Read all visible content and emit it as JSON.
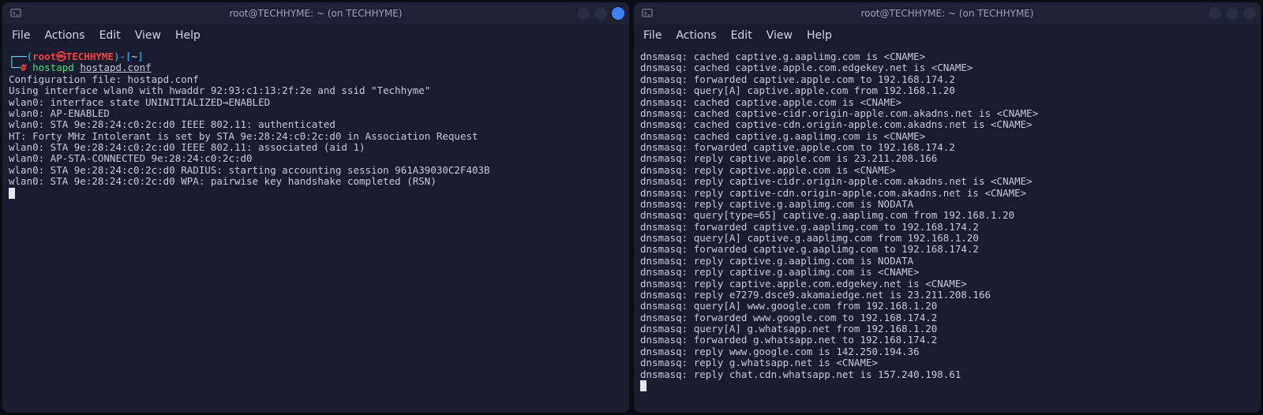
{
  "menus": [
    "File",
    "Actions",
    "Edit",
    "View",
    "Help"
  ],
  "left": {
    "title": "root@TECHHYME: ~ (on TECHHYME)",
    "prompt": {
      "user": "root",
      "symbol": "㉿",
      "host": "TECHHYME",
      "cwd": "~",
      "marker": "#",
      "command": "hostapd",
      "arg": "hostapd.conf"
    },
    "output": [
      "Configuration file: hostapd.conf",
      "Using interface wlan0 with hwaddr 92:93:c1:13:2f:2e and ssid \"Techhyme\"",
      "wlan0: interface state UNINITIALIZED→ENABLED",
      "wlan0: AP-ENABLED",
      "wlan0: STA 9e:28:24:c0:2c:d0 IEEE 802.11: authenticated",
      "HT: Forty MHz Intolerant is set by STA 9e:28:24:c0:2c:d0 in Association Request",
      "wlan0: STA 9e:28:24:c0:2c:d0 IEEE 802.11: associated (aid 1)",
      "wlan0: AP-STA-CONNECTED 9e:28:24:c0:2c:d0",
      "wlan0: STA 9e:28:24:c0:2c:d0 RADIUS: starting accounting session 961A39030C2F403B",
      "wlan0: STA 9e:28:24:c0:2c:d0 WPA: pairwise key handshake completed (RSN)"
    ]
  },
  "right": {
    "title": "root@TECHHYME: ~ (on TECHHYME)",
    "output": [
      "dnsmasq: cached captive.g.aaplimg.com is <CNAME>",
      "dnsmasq: cached captive.apple.com.edgekey.net is <CNAME>",
      "dnsmasq: forwarded captive.apple.com to 192.168.174.2",
      "dnsmasq: query[A] captive.apple.com from 192.168.1.20",
      "dnsmasq: cached captive.apple.com is <CNAME>",
      "dnsmasq: cached captive-cidr.origin-apple.com.akadns.net is <CNAME>",
      "dnsmasq: cached captive-cdn.origin-apple.com.akadns.net is <CNAME>",
      "dnsmasq: cached captive.g.aaplimg.com is <CNAME>",
      "dnsmasq: forwarded captive.apple.com to 192.168.174.2",
      "dnsmasq: reply captive.apple.com is 23.211.208.166",
      "dnsmasq: reply captive.apple.com is <CNAME>",
      "dnsmasq: reply captive-cidr.origin-apple.com.akadns.net is <CNAME>",
      "dnsmasq: reply captive-cdn.origin-apple.com.akadns.net is <CNAME>",
      "dnsmasq: reply captive.g.aaplimg.com is NODATA",
      "dnsmasq: query[type=65] captive.g.aaplimg.com from 192.168.1.20",
      "dnsmasq: forwarded captive.g.aaplimg.com to 192.168.174.2",
      "dnsmasq: query[A] captive.g.aaplimg.com from 192.168.1.20",
      "dnsmasq: forwarded captive.g.aaplimg.com to 192.168.174.2",
      "dnsmasq: reply captive.g.aaplimg.com is NODATA",
      "dnsmasq: reply captive.g.aaplimg.com is <CNAME>",
      "dnsmasq: reply captive.apple.com.edgekey.net is <CNAME>",
      "dnsmasq: reply e7279.dsce9.akamaiedge.net is 23.211.208.166",
      "dnsmasq: query[A] www.google.com from 192.168.1.20",
      "dnsmasq: forwarded www.google.com to 192.168.174.2",
      "dnsmasq: query[A] g.whatsapp.net from 192.168.1.20",
      "dnsmasq: forwarded g.whatsapp.net to 192.168.174.2",
      "dnsmasq: reply www.google.com is 142.250.194.36",
      "dnsmasq: reply g.whatsapp.net is <CNAME>",
      "dnsmasq: reply chat.cdn.whatsapp.net is 157.240.198.61"
    ]
  }
}
